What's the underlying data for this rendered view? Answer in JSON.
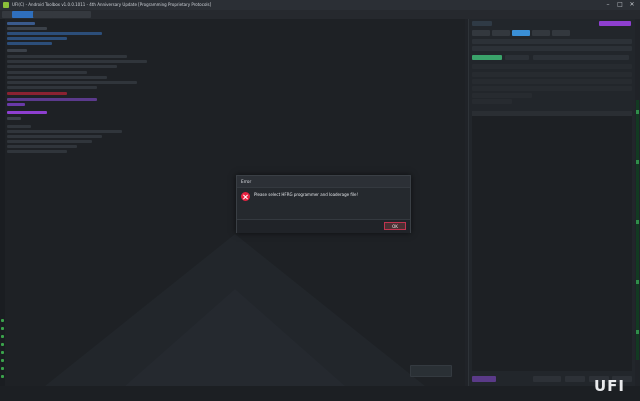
{
  "window": {
    "title": "UFI(C) - Android Toolbox v1.0.0.1011 - 4th Anniversary Update [Programming Proprietary Protocols]",
    "controls": {
      "minimize": "–",
      "maximize": "□",
      "close": "✕"
    }
  },
  "dialog": {
    "title": "Error",
    "message": "Please select HFRG programmer and loaderage file!",
    "ok_label": "OK",
    "icon": "error-icon"
  },
  "brand": {
    "logo_text": "UFI"
  },
  "colors": {
    "accent": "#8e3fd0",
    "error": "#e8213f",
    "selection": "#2f6fbd"
  }
}
